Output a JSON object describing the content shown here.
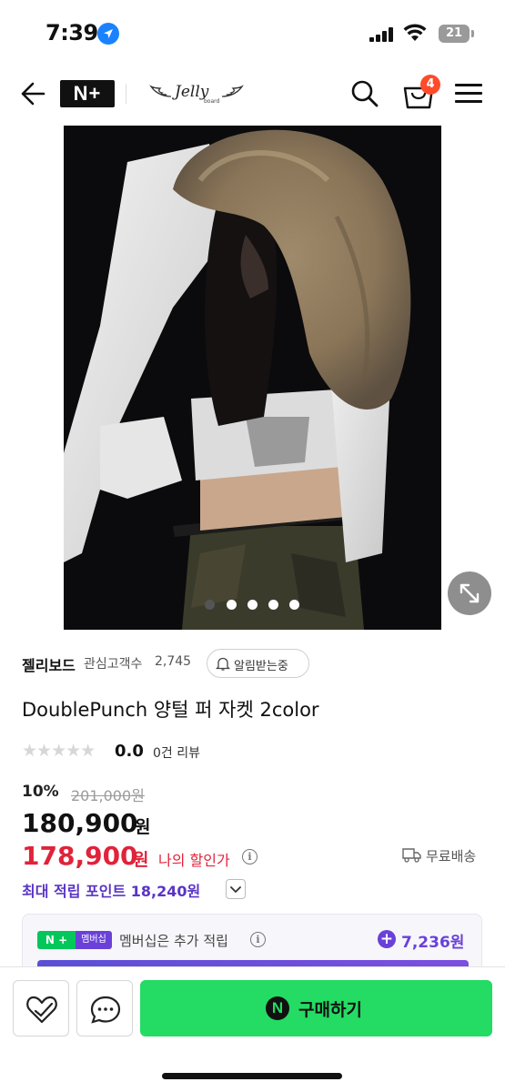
{
  "status_bar": {
    "time": "7:39",
    "battery": "21"
  },
  "header": {
    "logo": "N+",
    "store_logo_name": "Jelly",
    "store_logo_sub": "board",
    "cart_count": "4"
  },
  "gallery": {
    "total": 5,
    "active_index": 0
  },
  "store": {
    "name": "젤리보드",
    "fav_label": "관심고객수",
    "fav_count": "2,745",
    "notify_label": "알림받는중"
  },
  "product": {
    "title": "DoublePunch 양털 퍼 자켓 2color",
    "stars": "★★★★★",
    "rating": "0.0",
    "review_count": "0건 리뷰",
    "discount_rate": "10%",
    "original_price": "201,000원",
    "sale_price": "180,900",
    "sale_unit": "원",
    "my_price": "178,900",
    "my_unit": "원",
    "my_price_label": "나의 할인가",
    "free_shipping": "무료배송",
    "points_label": "최대 적립 포인트 18,240원"
  },
  "membership": {
    "badge_np": "N +",
    "badge_label": "멤버십",
    "text": "멤버십은 추가 적립",
    "points": "7,236원"
  },
  "bottom_bar": {
    "buy_logo": "N",
    "buy_label": "구매하기"
  },
  "colors": {
    "accent_red": "#e0233a",
    "accent_purple": "#6a41d8",
    "naver_green": "#24db63"
  }
}
